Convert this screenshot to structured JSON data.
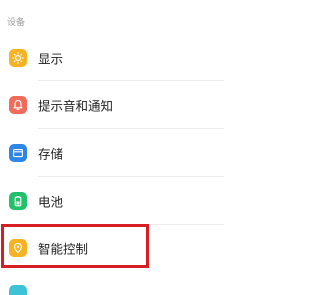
{
  "section": {
    "title": "设备"
  },
  "items": [
    {
      "label": "显示",
      "icon": "brightness-icon",
      "color": "#f5b324"
    },
    {
      "label": "提示音和通知",
      "icon": "bell-icon",
      "color": "#f06b5a"
    },
    {
      "label": "存储",
      "icon": "storage-icon",
      "color": "#2e86e8"
    },
    {
      "label": "电池",
      "icon": "battery-icon",
      "color": "#22c06b"
    },
    {
      "label": "智能控制",
      "icon": "smart-control-icon",
      "color": "#f5b324"
    }
  ],
  "highlight": {
    "color": "#d81e25",
    "target": "智能控制"
  },
  "partial_next_item": {
    "icon": "partial-icon",
    "color": "#3ec3d6"
  }
}
